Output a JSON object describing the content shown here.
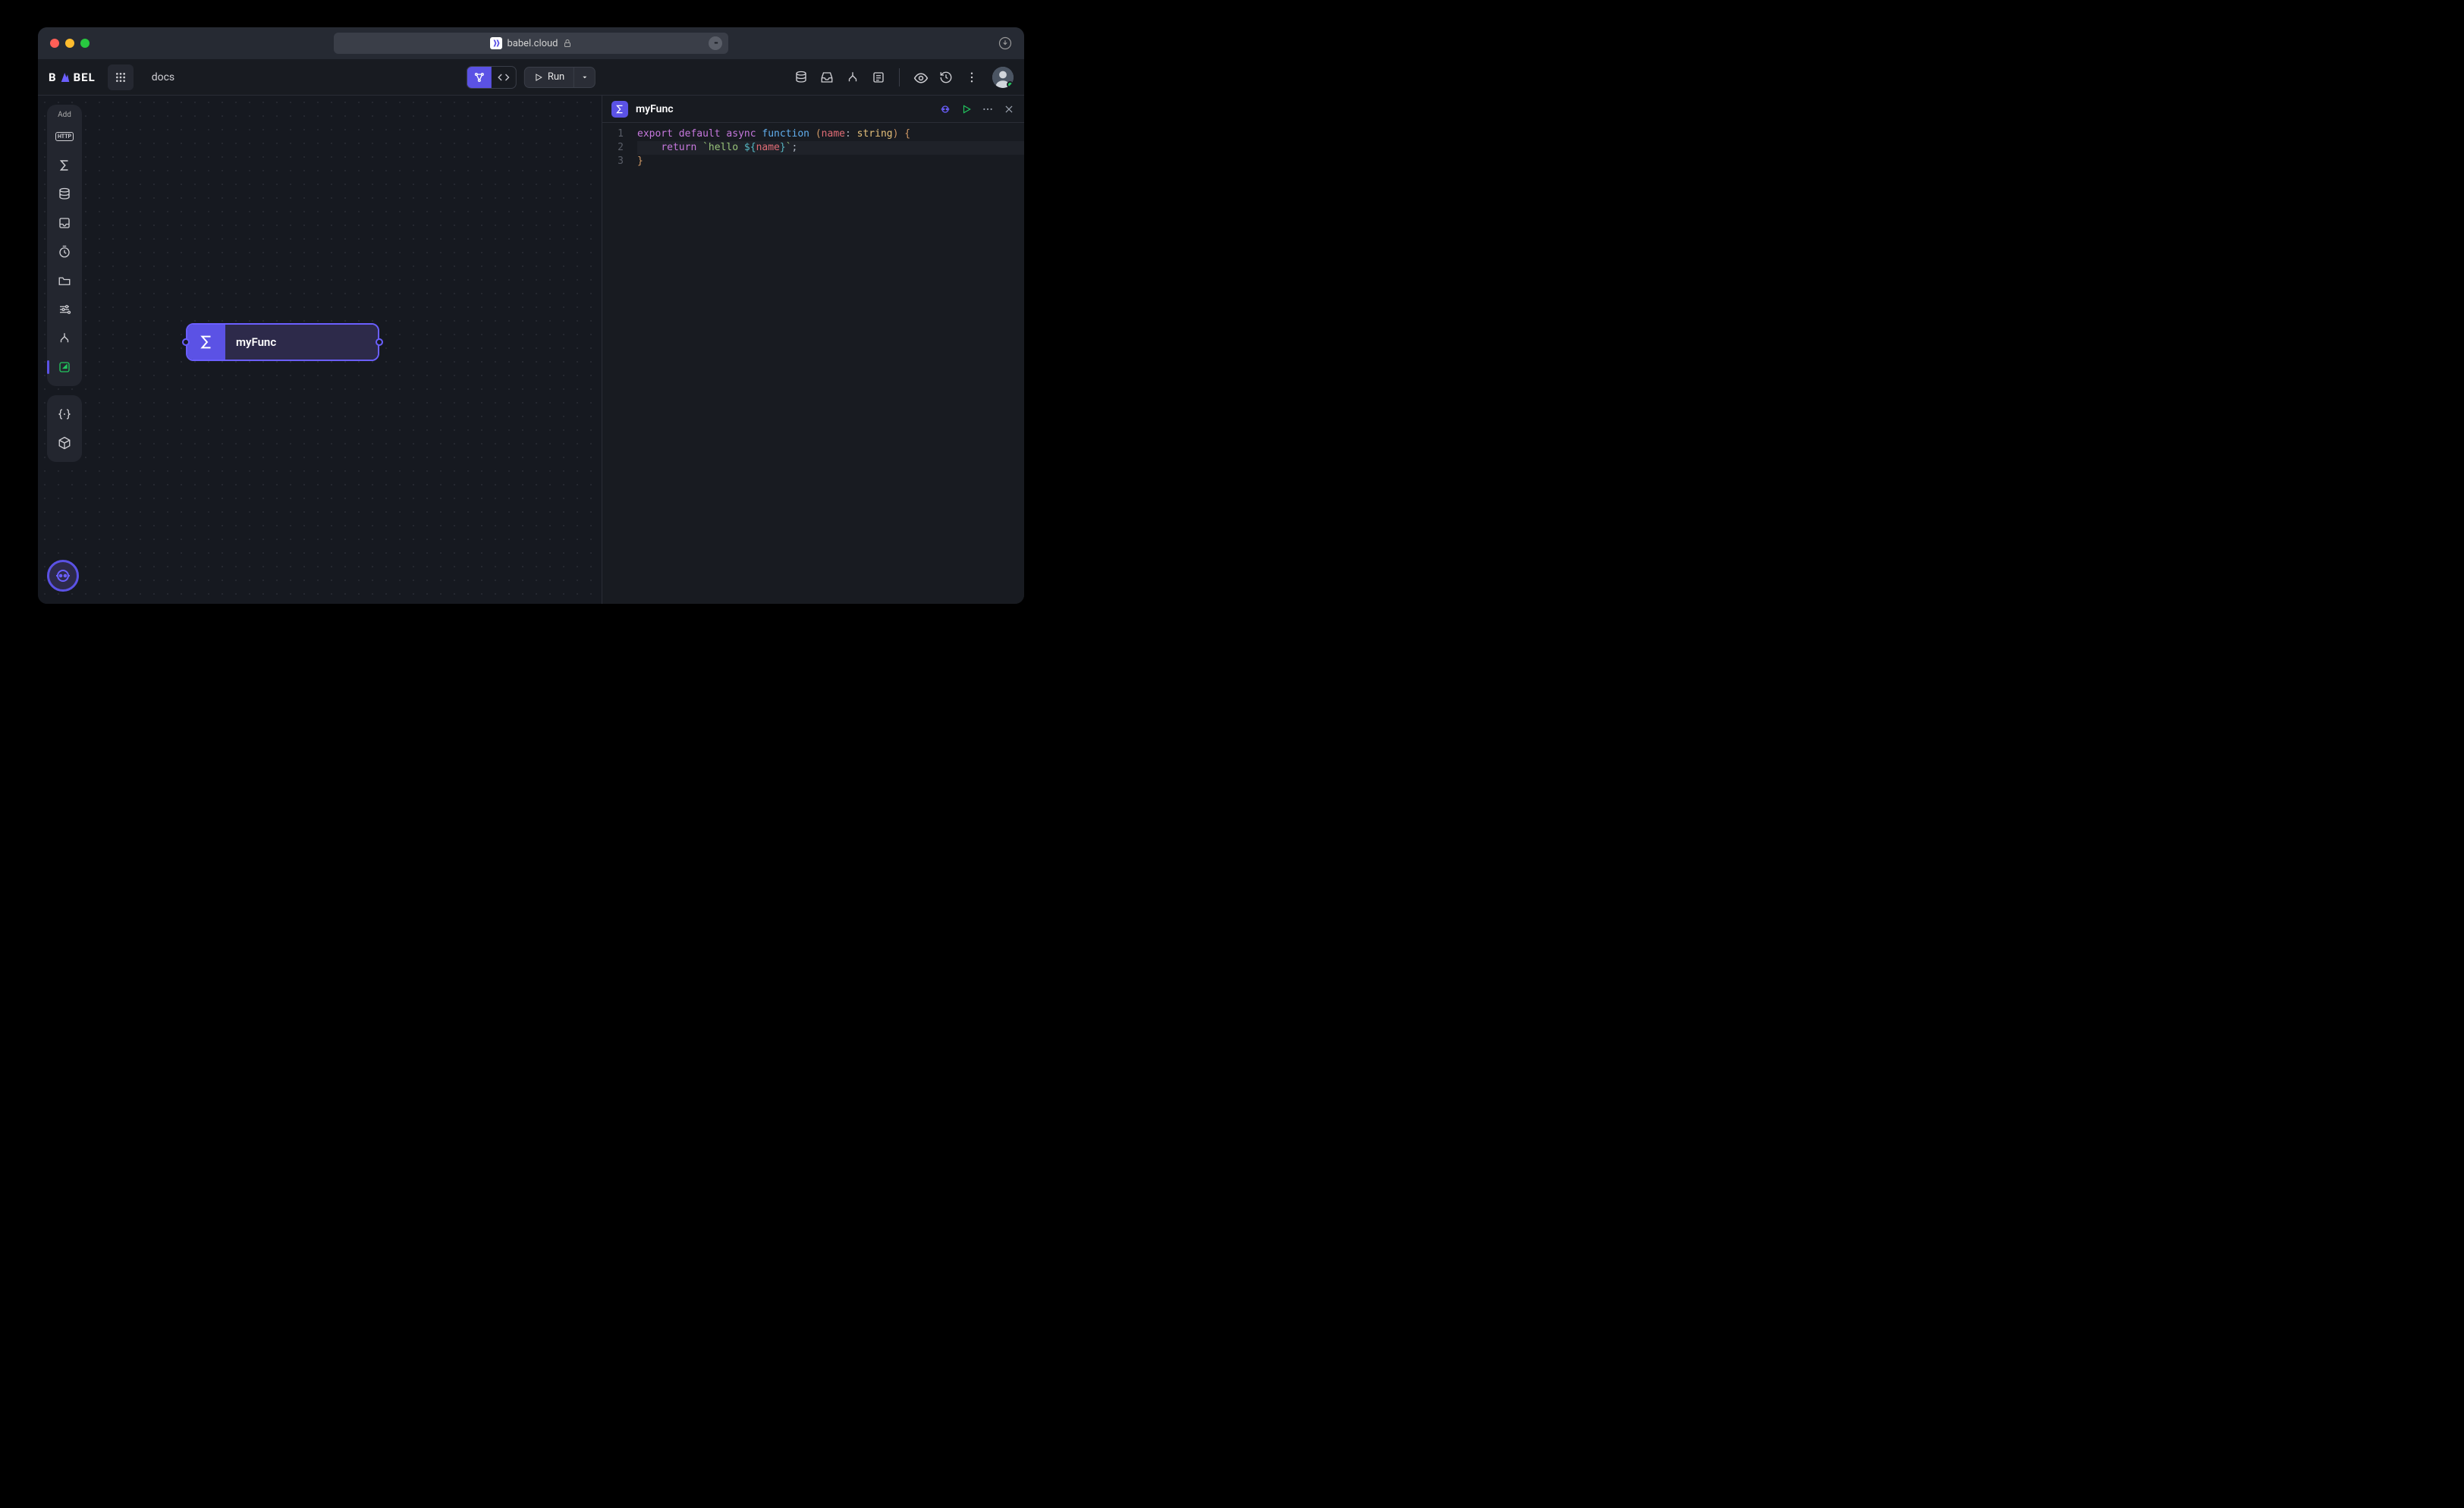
{
  "browser": {
    "url": "babel.cloud"
  },
  "topbar": {
    "logo_prefix": "B",
    "logo_suffix": "BEL",
    "breadcrumb": "docs",
    "run_label": "Run"
  },
  "left_rail": {
    "add_label": "Add",
    "http_badge": "HTTP"
  },
  "canvas": {
    "node_title": "myFunc"
  },
  "editor": {
    "title": "myFunc",
    "lines": [
      "1",
      "2",
      "3"
    ],
    "code": {
      "l1_export": "export",
      "l1_default": "default",
      "l1_async": "async",
      "l1_function": "function",
      "l1_open": "(",
      "l1_name": "name",
      "l1_colon": ": ",
      "l1_type": "string",
      "l1_close": ")",
      "l1_brace": " {",
      "l2_indent": "    ",
      "l2_return": "return",
      "l2_str_open": " `hello ",
      "l2_tmpl_open": "${",
      "l2_var": "name",
      "l2_tmpl_close": "}",
      "l2_str_close": "`",
      "l2_semi": ";",
      "l3_brace": "}"
    }
  }
}
